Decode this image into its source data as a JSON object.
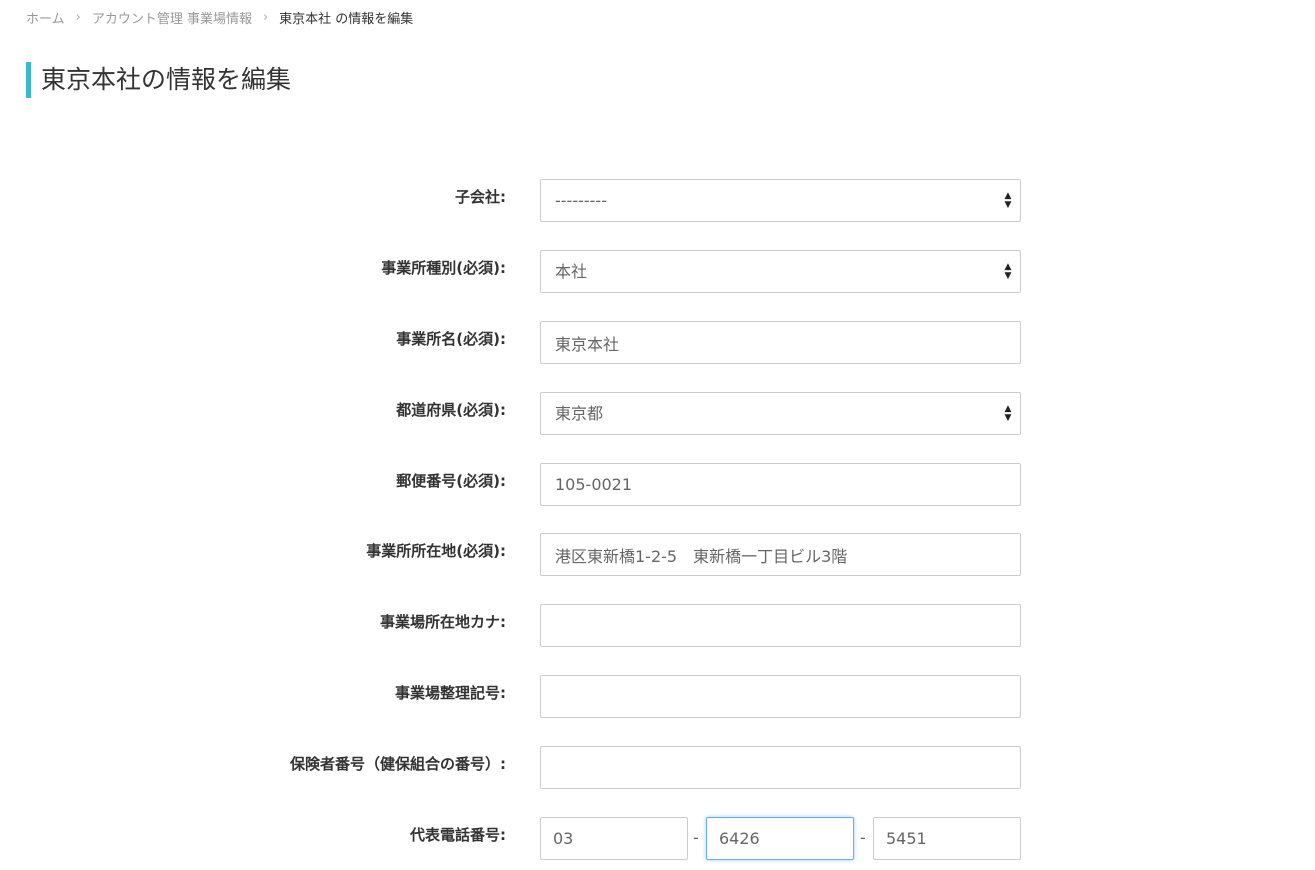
{
  "breadcrumb": {
    "home": "ホーム",
    "section": "アカウント管理 事業場情報",
    "current": "東京本社 の情報を編集"
  },
  "page": {
    "title": "東京本社の情報を編集",
    "accent_color": "#3bb7d0"
  },
  "form": {
    "subsidiary": {
      "label": "子会社:",
      "value": "---------"
    },
    "office_type": {
      "label": "事業所種別(必須):",
      "value": "本社"
    },
    "office_name": {
      "label": "事業所名(必須):",
      "value": "東京本社"
    },
    "prefecture": {
      "label": "都道府県(必須):",
      "value": "東京都"
    },
    "postal_code": {
      "label": "郵便番号(必須):",
      "value": "105-0021"
    },
    "address": {
      "label": "事業所所在地(必須):",
      "value": "港区東新橋1-2-5　東新橋一丁目ビル3階"
    },
    "address_kana": {
      "label": "事業場所在地カナ:",
      "value": ""
    },
    "reference_number": {
      "label": "事業場整理記号:",
      "value": ""
    },
    "insurer_number": {
      "label": "保険者番号（健保組合の番号）:",
      "value": ""
    },
    "phone": {
      "label": "代表電話番号:",
      "part1": "03",
      "part2": "6426",
      "part3": "5451",
      "separator": "-"
    }
  },
  "icons": {
    "select_arrow": "up-down-arrows-icon",
    "breadcrumb_separator": "chevron-right-icon"
  }
}
